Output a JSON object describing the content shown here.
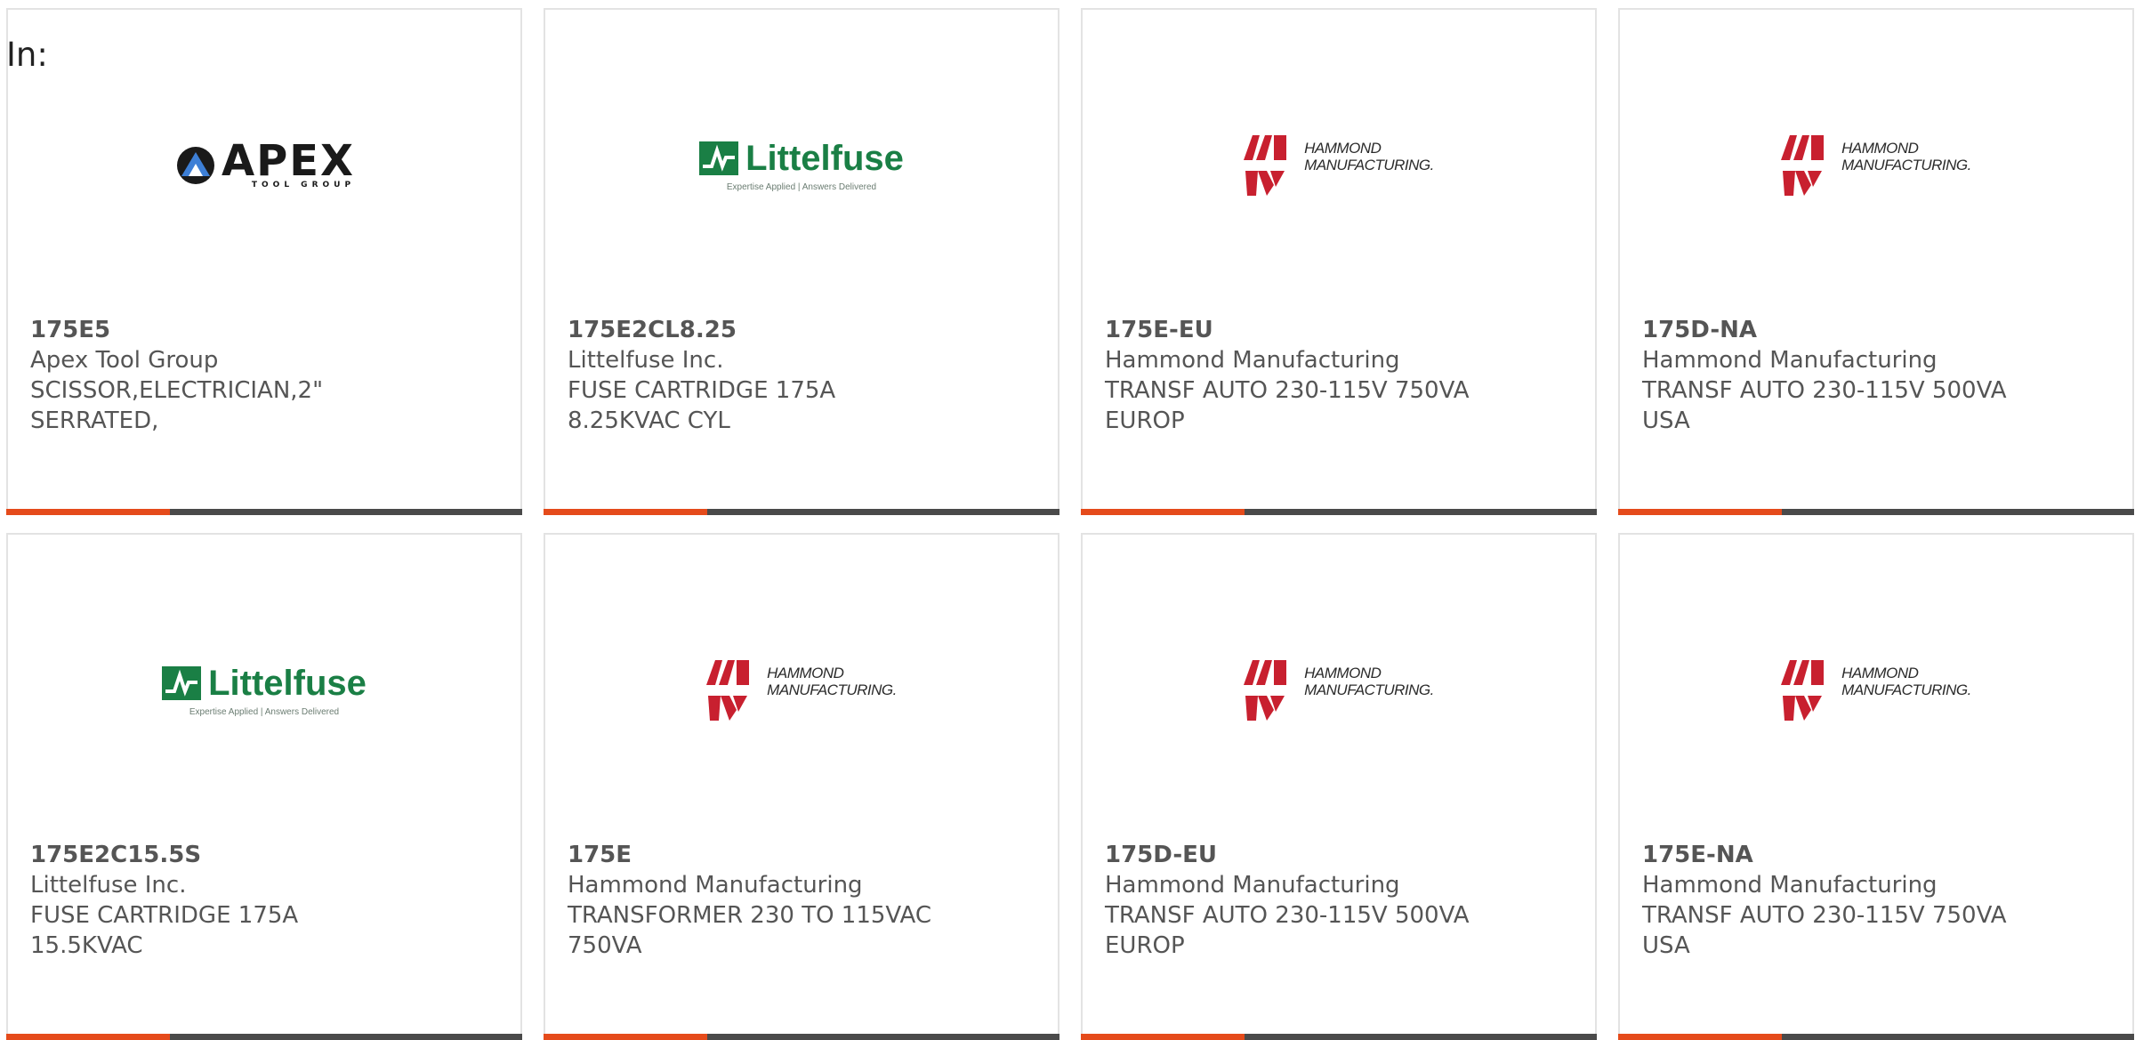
{
  "header": {
    "label": "In:"
  },
  "colors": {
    "accent_bar": "#e54b1b",
    "dark_bar": "#4a4a4a",
    "card_border": "#e3e3e3",
    "apex_logo": "#1a1a1a",
    "littelfuse_green": "#1a7f45",
    "hammond_red": "#c8202f"
  },
  "logos": {
    "apex": {
      "icon": "apex-logo-icon",
      "name": "APEX",
      "sub": "TOOL GROUP"
    },
    "littelfuse": {
      "icon": "littelfuse-logo-icon",
      "name": "Littelfuse",
      "tag": "Expertise Applied | Answers Delivered"
    },
    "hammond": {
      "icon": "hammond-logo-icon",
      "line1": "HAMMOND",
      "line2": "MANUFACTURING."
    }
  },
  "products": [
    {
      "logo": "apex",
      "part": "175E5",
      "manufacturer": "Apex Tool Group",
      "description": "SCISSOR,ELECTRICIAN,2\"\nSERRATED,"
    },
    {
      "logo": "littelfuse",
      "part": "175E2CL8.25",
      "manufacturer": "Littelfuse Inc.",
      "description": "FUSE CARTRIDGE 175A\n8.25KVAC CYL"
    },
    {
      "logo": "hammond",
      "part": "175E-EU",
      "manufacturer": "Hammond Manufacturing",
      "description": "TRANSF AUTO 230-115V 750VA\nEUROP"
    },
    {
      "logo": "hammond",
      "part": "175D-NA",
      "manufacturer": "Hammond Manufacturing",
      "description": "TRANSF AUTO 230-115V 500VA\nUSA"
    },
    {
      "logo": "littelfuse",
      "part": "175E2C15.5S",
      "manufacturer": "Littelfuse Inc.",
      "description": "FUSE CARTRIDGE 175A\n15.5KVAC"
    },
    {
      "logo": "hammond",
      "part": "175E",
      "manufacturer": "Hammond Manufacturing",
      "description": "TRANSFORMER 230 TO 115VAC\n750VA"
    },
    {
      "logo": "hammond",
      "part": "175D-EU",
      "manufacturer": "Hammond Manufacturing",
      "description": "TRANSF AUTO 230-115V 500VA\nEUROP"
    },
    {
      "logo": "hammond",
      "part": "175E-NA",
      "manufacturer": "Hammond Manufacturing",
      "description": "TRANSF AUTO 230-115V 750VA\nUSA"
    }
  ]
}
